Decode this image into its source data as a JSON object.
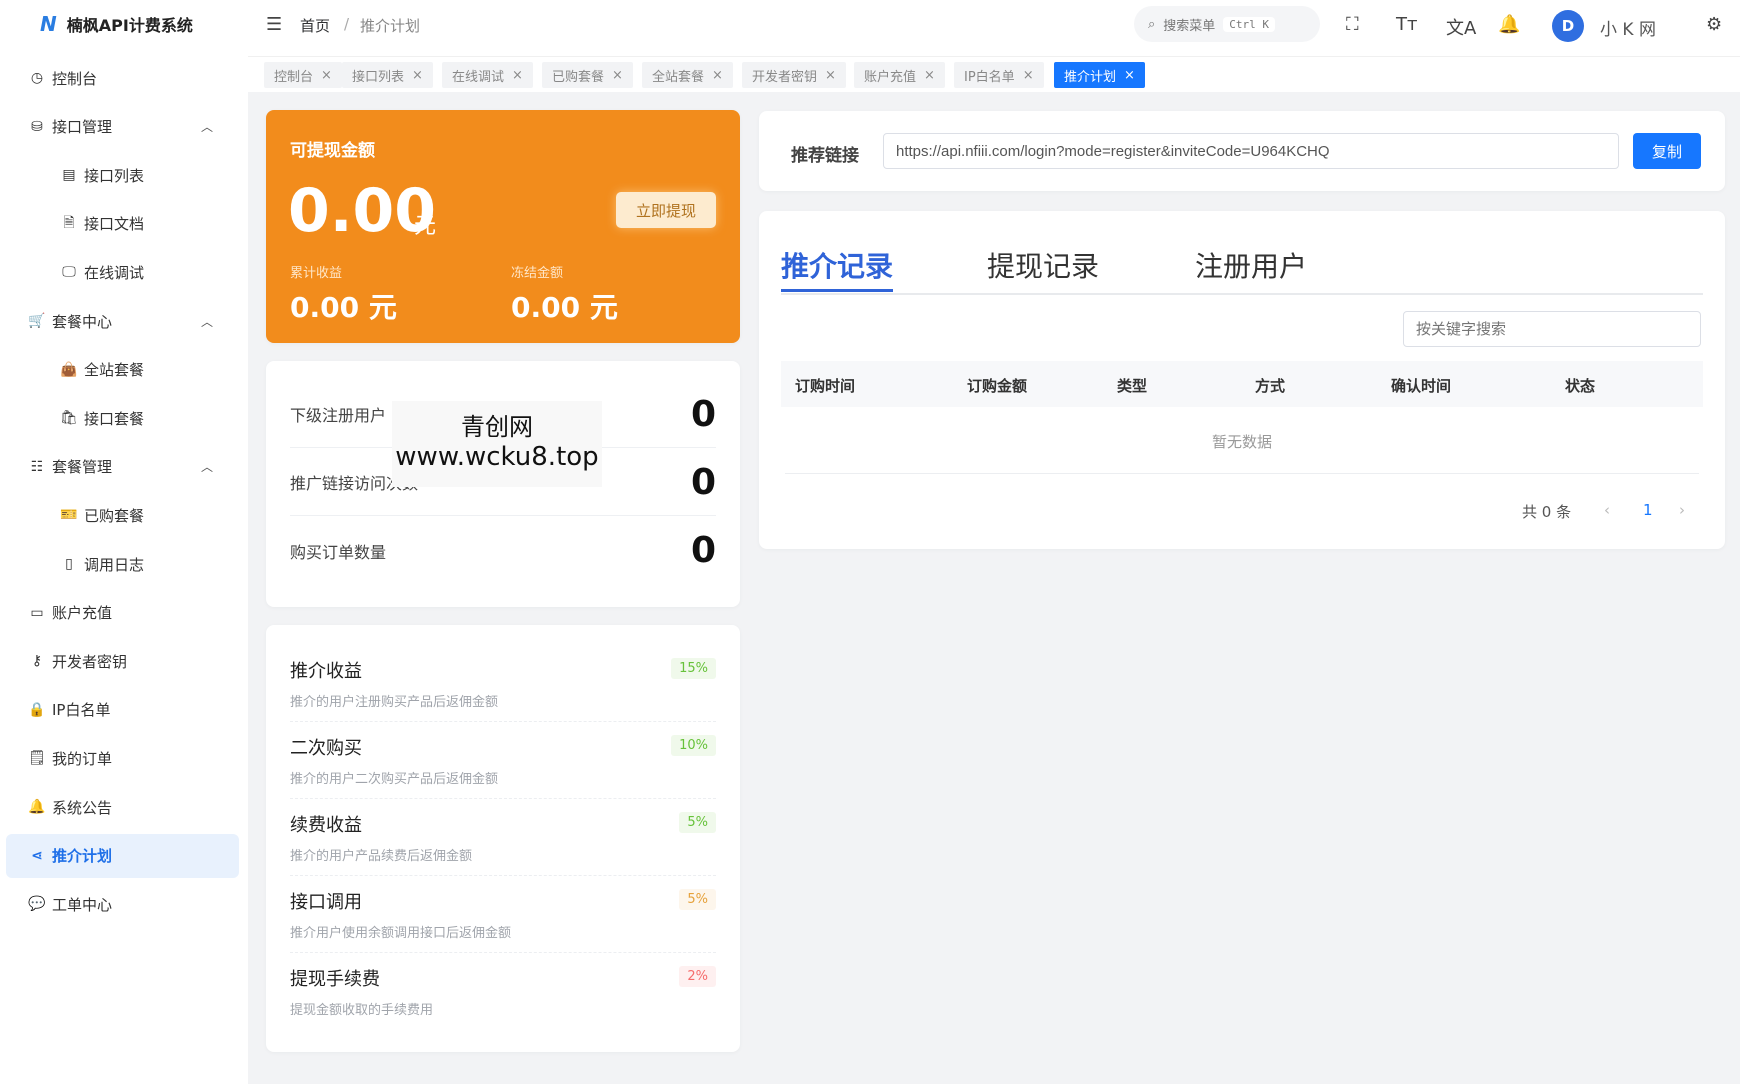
{
  "app": {
    "title": "楠枫API计费系统",
    "logo_letter": "N"
  },
  "sidebar": {
    "items": [
      {
        "label": "控制台",
        "icon": "gauge-icon",
        "glyph": "◷"
      },
      {
        "label": "接口管理",
        "icon": "api-icon",
        "glyph": "⛁",
        "expand": "up"
      },
      {
        "label": "接口列表",
        "icon": "list-icon",
        "glyph": "▤",
        "sub": true
      },
      {
        "label": "接口文档",
        "icon": "document-icon",
        "glyph": "🗎",
        "sub": true
      },
      {
        "label": "在线调试",
        "icon": "monitor-icon",
        "glyph": "🖵",
        "sub": true
      },
      {
        "label": "套餐中心",
        "icon": "cart-icon",
        "glyph": "🛒",
        "expand": "up"
      },
      {
        "label": "全站套餐",
        "icon": "bag-filled-icon",
        "glyph": "👜",
        "sub": true
      },
      {
        "label": "接口套餐",
        "icon": "bag-icon",
        "glyph": "🛍",
        "sub": true
      },
      {
        "label": "套餐管理",
        "icon": "list-alt-icon",
        "glyph": "☷",
        "expand": "up"
      },
      {
        "label": "已购套餐",
        "icon": "ticket-icon",
        "glyph": "🎫",
        "sub": true
      },
      {
        "label": "调用日志",
        "icon": "notebook-icon",
        "glyph": "▯",
        "sub": true
      },
      {
        "label": "账户充值",
        "icon": "wallet-icon",
        "glyph": "▭"
      },
      {
        "label": "开发者密钥",
        "icon": "key-icon",
        "glyph": "⚷"
      },
      {
        "label": "IP白名单",
        "icon": "lock-icon",
        "glyph": "🔒"
      },
      {
        "label": "我的订单",
        "icon": "order-icon",
        "glyph": "🗒"
      },
      {
        "label": "系统公告",
        "icon": "bell-icon",
        "glyph": "🔔"
      },
      {
        "label": "推介计划",
        "icon": "share-icon",
        "glyph": "⋖",
        "active": true
      },
      {
        "label": "工单中心",
        "icon": "chat-icon",
        "glyph": "💬"
      }
    ]
  },
  "header": {
    "breadcrumb": [
      "首页",
      "推介计划"
    ],
    "separator": "/",
    "search_placeholder": "搜索菜单",
    "search_shortcut": "Ctrl K",
    "avatar_letter": "D",
    "username": "小 K 网"
  },
  "tabs": [
    {
      "label": "控制台"
    },
    {
      "label": "接口列表"
    },
    {
      "label": "在线调试"
    },
    {
      "label": "已购套餐"
    },
    {
      "label": "全站套餐"
    },
    {
      "label": "开发者密钥"
    },
    {
      "label": "账户充值"
    },
    {
      "label": "IP白名单"
    },
    {
      "label": "推介计划",
      "active": true
    }
  ],
  "balance": {
    "title": "可提现金额",
    "amount": "0.00",
    "unit": "元",
    "withdraw_label": "立即提现",
    "total_label": "累计收益",
    "total_value": "0.00 元",
    "frozen_label": "冻结金额",
    "frozen_value": "0.00 元"
  },
  "stats": [
    {
      "label": "下级注册用户",
      "value": "0"
    },
    {
      "label": "推广链接访问次数",
      "value": "0"
    },
    {
      "label": "购买订单数量",
      "value": "0"
    }
  ],
  "watermark": {
    "line1": "青创网",
    "line2": "www.wcku8.top"
  },
  "rates": [
    {
      "title": "推介收益",
      "desc": "推介的用户注册购买产品后返佣金额",
      "badge": "15%",
      "color": "#67c23a",
      "bg": "#f0f9eb"
    },
    {
      "title": "二次购买",
      "desc": "推介的用户二次购买产品后返佣金额",
      "badge": "10%",
      "color": "#67c23a",
      "bg": "#f0f9eb"
    },
    {
      "title": "续费收益",
      "desc": "推介的用户产品续费后返佣金额",
      "badge": "5%",
      "color": "#67c23a",
      "bg": "#f0f9eb"
    },
    {
      "title": "接口调用",
      "desc": "推介用户使用余额调用接口后返佣金额",
      "badge": "5%",
      "color": "#e6a23c",
      "bg": "#fdf6ec"
    },
    {
      "title": "提现手续费",
      "desc": "提现金额收取的手续费用",
      "badge": "2%",
      "color": "#f56c6c",
      "bg": "#fef0f0"
    }
  ],
  "link": {
    "label": "推荐链接",
    "value": "https://api.nfiii.com/login?mode=register&inviteCode=U964KCHQ",
    "copy_label": "复制"
  },
  "records": {
    "tabs": [
      "推介记录",
      "提现记录",
      "注册用户"
    ],
    "search_placeholder": "按关键字搜索",
    "columns": [
      "订购时间",
      "订购金额",
      "类型",
      "方式",
      "确认时间",
      "状态"
    ],
    "empty": "暂无数据",
    "total": "共 0 条",
    "page": "1"
  }
}
